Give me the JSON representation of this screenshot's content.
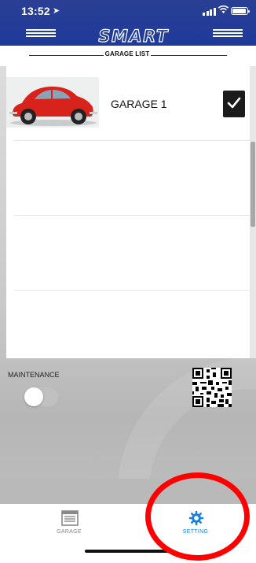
{
  "status_bar": {
    "time": "13:52",
    "location_icon": "location-arrow-icon"
  },
  "header": {
    "logo_text": "SMART GARAGE"
  },
  "subheader": {
    "label": "GARAGE LIST"
  },
  "garages": [
    {
      "name": "GARAGE 1",
      "selected": true
    }
  ],
  "maintenance": {
    "label": "MAINTENANCE",
    "enabled": false
  },
  "tabs": [
    {
      "label": "GARAGE",
      "icon": "garage-icon",
      "active": false
    },
    {
      "label": "SETTING",
      "icon": "gear-icon",
      "active": true
    }
  ],
  "colors": {
    "header_blue": "#1f3a9a",
    "active_tab": "#1a7fe0",
    "annotation": "#ff0000"
  }
}
